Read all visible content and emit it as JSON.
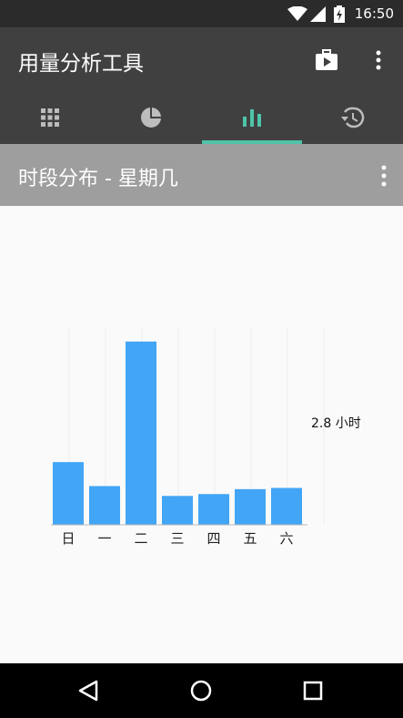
{
  "status": {
    "time": "16:50"
  },
  "app": {
    "title": "用量分析工具"
  },
  "tabs": [
    {
      "icon": "grid-icon"
    },
    {
      "icon": "pie-chart-icon"
    },
    {
      "icon": "bar-chart-icon",
      "selected": true
    },
    {
      "icon": "history-icon"
    }
  ],
  "section": {
    "title": "时段分布 - 星期几"
  },
  "colors": {
    "bar": "#42a5f5",
    "accent": "#4fc3a8",
    "header": "#9e9e9e",
    "app_bar": "#404040"
  },
  "chart_data": {
    "type": "bar",
    "categories": [
      "日",
      "一",
      "二",
      "三",
      "四",
      "五",
      "六"
    ],
    "values": [
      1.02,
      0.63,
      2.98,
      0.47,
      0.5,
      0.58,
      0.6
    ],
    "ylim": [
      0,
      3.2
    ],
    "grid": true,
    "max_label": "2.8 小时"
  }
}
